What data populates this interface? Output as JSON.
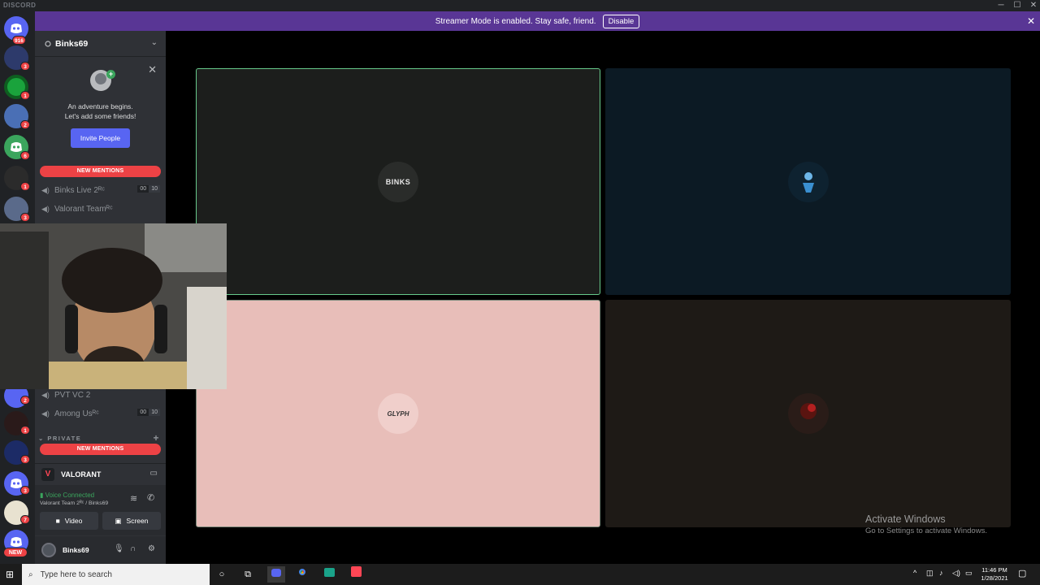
{
  "window": {
    "brand": "DISCORD",
    "controls": [
      "─",
      "☐",
      "✕"
    ]
  },
  "banner": {
    "message": "Streamer Mode is enabled. Stay safe, friend.",
    "button_label": "Disable",
    "close_glyph": "✕"
  },
  "rail": {
    "servers": [
      {
        "badge": "916",
        "color": "#5865f2"
      },
      {
        "badge": "3",
        "color": "#2d3a6b"
      },
      {
        "badge": "1",
        "color": "#1aa33c"
      },
      {
        "badge": "2",
        "color": "#4a6fb5"
      },
      {
        "badge": "6",
        "color": "#3ba55d"
      },
      {
        "badge": "1",
        "color": "#2b2b2b"
      },
      {
        "badge": "3",
        "color": "#5a6a8a"
      },
      {
        "badge": "2",
        "color": "#5865f2"
      },
      {
        "badge": "1",
        "color": "#2a1a1a"
      },
      {
        "badge": "3",
        "color": "#1c2b66"
      },
      {
        "badge": "3",
        "color": "#5865f2"
      },
      {
        "badge": "7",
        "color": "#e8e2d0"
      },
      {
        "badge": "NEW",
        "color": "#5865f2"
      }
    ]
  },
  "sidebar": {
    "guild_name": "Binks69",
    "invite": {
      "line1": "An adventure begins.",
      "line2": "Let's add some friends!",
      "button": "Invite People"
    },
    "new_mentions": "NEW MENTIONS",
    "channels_top": [
      {
        "name": "Binks Live 2ᴿᶜ",
        "limit_a": "00",
        "limit_b": "10"
      },
      {
        "name": "Valorant Teamᴿᶜ"
      }
    ],
    "channels_bottom": [
      {
        "name": "PVT VC 2"
      },
      {
        "name": "Among Usᴿᶜ",
        "limit_a": "00",
        "limit_b": "10"
      }
    ],
    "category": "PRIVATE",
    "game": {
      "name": "VALORANT"
    },
    "voice": {
      "status": "Voice Connected",
      "channel": "Valorant Team 2ᴿᶜ / Binks69",
      "video_label": "Video",
      "screen_label": "Screen"
    },
    "user": {
      "name": "Binks69"
    }
  },
  "stage": {
    "tiles": [
      {
        "label": "BINKS",
        "bg": "#1c1e1c",
        "border": "#67c98b"
      },
      {
        "label": "",
        "bg": "#0c1a24",
        "border": ""
      },
      {
        "label": "GLYPH",
        "bg": "#e8beb9",
        "border": "#7b8a7b"
      },
      {
        "label": "",
        "bg": "#1e1a16",
        "border": ""
      }
    ]
  },
  "watermark": {
    "title": "Activate Windows",
    "subtitle": "Go to Settings to activate Windows."
  },
  "taskbar": {
    "search_placeholder": "Type here to search",
    "time": "11:46 PM",
    "date": "1/28/2021"
  }
}
